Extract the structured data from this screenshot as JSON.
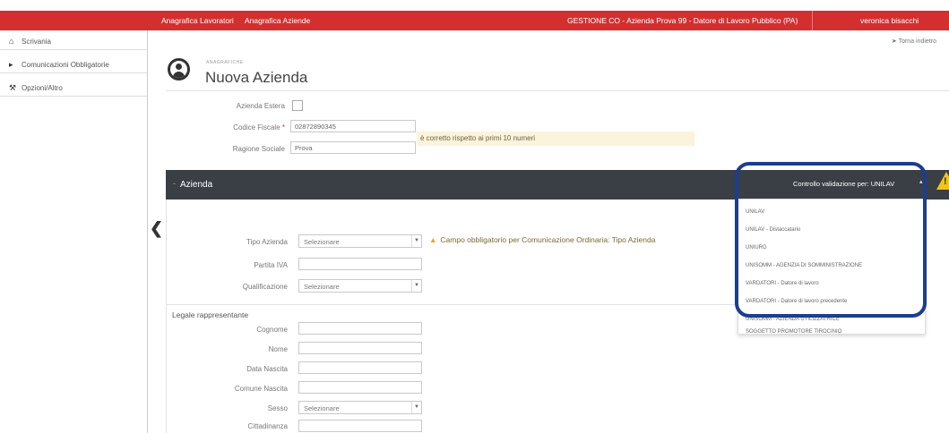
{
  "topbar": {
    "nav": [
      "Anagrafica Lavoratori",
      "Anagrafica Aziende"
    ],
    "context": "GESTIONE CO - Azienda Prova 99 - Datore di Lavoro Pubblico (PA)",
    "user": "veronica bisacchi",
    "bg_color": "#d42f2f"
  },
  "sidebar": {
    "items": [
      {
        "icon": "home-icon",
        "label": "Scrivania"
      },
      {
        "icon": "megaphone-icon",
        "label": "Comunicazioni Obbligatorie"
      },
      {
        "icon": "wrench-icon",
        "label": "Opzioni/Altro"
      }
    ]
  },
  "header": {
    "back": "Torna indietro",
    "breadcrumb": "ANAGRAFICHE",
    "title": "Nuova Azienda"
  },
  "form": {
    "estera_label": "Azienda Estera",
    "cf_label": "Codice Fiscale",
    "cf_req": "*",
    "cf_value": "02872890345",
    "cf_hint": "è corretto rispetto ai primi 10 numeri",
    "ragione_label": "Ragione Sociale",
    "ragione_value": "Prova"
  },
  "azienda": {
    "title": "Azienda",
    "control_label": "Controllo validazione per: UNILAV",
    "tipo_label": "Tipo Azienda",
    "tipo_value": "Selezionare",
    "tipo_warning": "Campo obbligatorio per Comunicazione Ordinaria: Tipo Azienda",
    "piva_label": "Partita IVA",
    "qual_label": "Qualificazione",
    "qual_value": "Selezionare"
  },
  "legale": {
    "title": "Legale rappresentante",
    "cognome": "Cognome",
    "nome": "Nome",
    "data_nascita": "Data Nascita",
    "comune_nascita": "Comune Nascita",
    "sesso": "Sesso",
    "sesso_value": "Selezionare",
    "cittadinanza": "Cittadinanza"
  },
  "dropdown": {
    "options": [
      "UNILAV",
      "UNILAV - Distaccatario",
      "UNIURG",
      "UNISOMM - AGENZIA DI SOMMINISTRAZIONE",
      "VARDATORI - Datore di lavoro",
      "VARDATORI - Datore di lavoro precedente",
      "UNISOMM - AZIENDA UTILIZZATRICE",
      "SOGGETTO PROMOTORE TIROCINIO"
    ],
    "highlight_color": "#1c3e8c"
  }
}
